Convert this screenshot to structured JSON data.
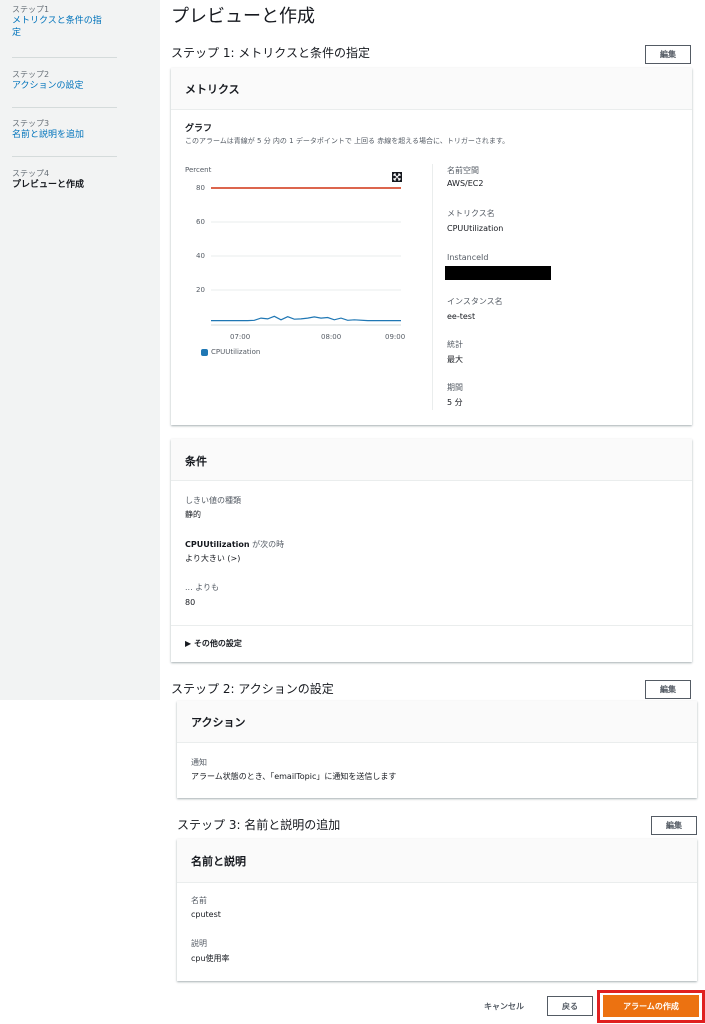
{
  "sidebar": {
    "steps": [
      {
        "num": "ステップ1",
        "label_lines": [
          "メトリクスと条件の指",
          "定"
        ]
      },
      {
        "num": "ステップ2",
        "label": "アクションの設定"
      },
      {
        "num": "ステップ3",
        "label": "名前と説明を追加"
      },
      {
        "num": "ステップ4",
        "label": "プレビューと作成"
      }
    ]
  },
  "page_title": "プレビューと作成",
  "edit_label": "編集",
  "step1": {
    "title": "ステップ 1: メトリクスと条件の指定",
    "metrics": {
      "header": "メトリクス",
      "graph_label": "グラフ",
      "graph_desc": "このアラームは青線が 5 分 内の 1 データポイントで 上回る 赤線を超える場合に、トリガーされます。",
      "props": [
        {
          "key": "名前空間",
          "value": "AWS/EC2"
        },
        {
          "key": "メトリクス名",
          "value": "CPUUtilization"
        },
        {
          "key": "InstanceId",
          "value": ""
        },
        {
          "key": "インスタンス名",
          "value": "ee-test"
        },
        {
          "key": "統計",
          "value": "最大"
        },
        {
          "key": "期間",
          "value": "5 分"
        }
      ]
    },
    "conditions": {
      "header": "条件",
      "threshold_type_label": "しきい値の種類",
      "threshold_type_value": "静的",
      "when_metric": "CPUUtilization",
      "when_suffix": "が次の時",
      "when_value": "より大きい (>)",
      "than_label": "... よりも",
      "than_value": "80",
      "other_settings": "▶ その他の設定"
    }
  },
  "step2": {
    "title": "ステップ 2: アクションの設定",
    "header": "アクション",
    "notify_label": "通知",
    "notify_value": "アラーム状態のとき、「emailTopic」に通知を送信します"
  },
  "step3": {
    "title": "ステップ 3: 名前と説明の追加",
    "header": "名前と説明",
    "name_label": "名前",
    "name_value": "cputest",
    "desc_label": "説明",
    "desc_value": "cpu使用率"
  },
  "footer": {
    "cancel": "キャンセル",
    "back": "戻る",
    "create": "アラームの作成"
  },
  "colors": {
    "primary": "#ec7211",
    "link": "#0073bb",
    "threshold_line": "#d13212",
    "series_line": "#1f77b4",
    "highlight": "#e02020"
  },
  "chart_data": {
    "type": "line",
    "ylabel": "Percent",
    "yticks": [
      "80",
      "60",
      "40",
      "20"
    ],
    "xticks": [
      "07:00",
      "08:00",
      "09:00"
    ],
    "threshold": 80,
    "series": [
      {
        "name": "CPUUtilization",
        "x": [
          "06:25",
          "06:35",
          "06:45",
          "06:55",
          "07:05",
          "07:10",
          "07:15",
          "07:20",
          "07:25",
          "07:30",
          "07:35",
          "07:40",
          "07:45",
          "07:50",
          "07:55",
          "08:00",
          "08:05",
          "08:10",
          "08:15",
          "08:20",
          "08:25",
          "08:35",
          "08:45",
          "08:55",
          "09:05"
        ],
        "values": [
          2.0,
          2.0,
          2.0,
          2.0,
          2.0,
          2.2,
          3.5,
          3.0,
          4.5,
          2.5,
          4.3,
          2.8,
          3.0,
          3.5,
          4.2,
          3.5,
          3.8,
          2.5,
          3.5,
          2.2,
          2.5,
          2.0,
          2.0,
          2.0,
          2.0
        ]
      }
    ]
  }
}
